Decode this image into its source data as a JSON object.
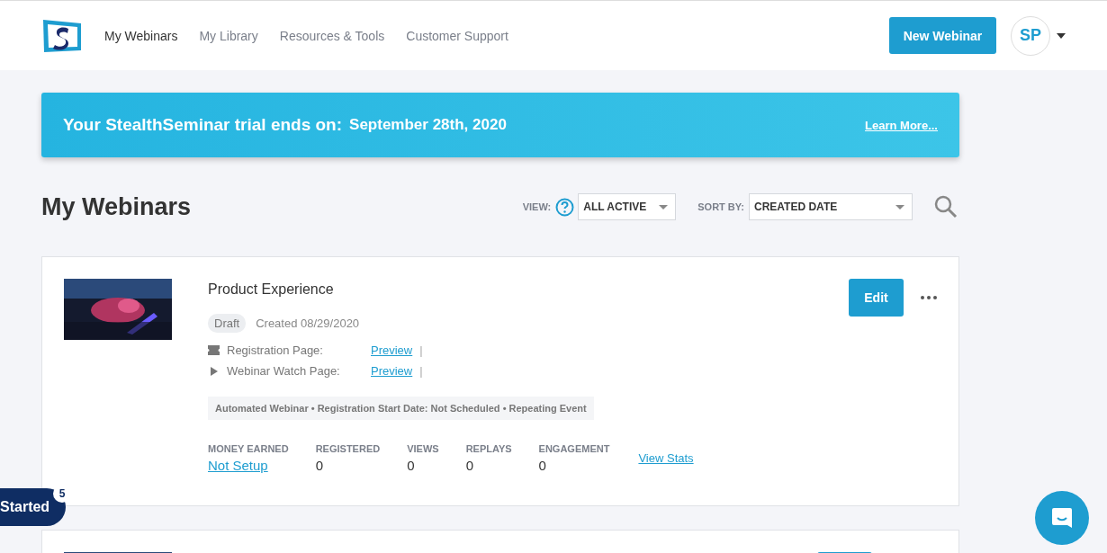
{
  "nav": {
    "items": [
      {
        "label": "My Webinars",
        "selected": true
      },
      {
        "label": "My Library",
        "selected": false
      },
      {
        "label": "Resources & Tools",
        "selected": false
      },
      {
        "label": "Customer Support",
        "selected": false
      }
    ],
    "new_button": "New Webinar",
    "avatar": "SP"
  },
  "banner": {
    "text": "Your StealthSeminar trial ends on:",
    "date": "September 28th, 2020",
    "link": "Learn More..."
  },
  "heading": "My Webinars",
  "filters": {
    "view_label": "VIEW:",
    "view_value": "ALL ACTIVE",
    "sort_label": "SORT BY:",
    "sort_value": "CREATED DATE"
  },
  "webinars": [
    {
      "title": "Product Experience",
      "status": "Draft",
      "created": "Created 08/29/2020",
      "pages": [
        {
          "kind": "registration",
          "label": "Registration Page:",
          "link": "Preview",
          "sep": "|"
        },
        {
          "kind": "watch",
          "label": "Webinar Watch Page:",
          "link": "Preview",
          "sep": "|"
        }
      ],
      "info": "Automated Webinar • Registration Start Date: Not Scheduled • Repeating Event",
      "edit": "Edit",
      "stats": [
        {
          "kind": "link",
          "label": "MONEY EARNED",
          "value": "Not Setup"
        },
        {
          "kind": "number",
          "label": "REGISTERED",
          "value": "0"
        },
        {
          "kind": "number",
          "label": "VIEWS",
          "value": "0"
        },
        {
          "kind": "number",
          "label": "REPLAYS",
          "value": "0"
        },
        {
          "kind": "number",
          "label": "ENGAGEMENT",
          "value": "0"
        }
      ],
      "stats_link": "View Stats"
    }
  ],
  "getting_started": {
    "label": "Started",
    "count": "5"
  }
}
